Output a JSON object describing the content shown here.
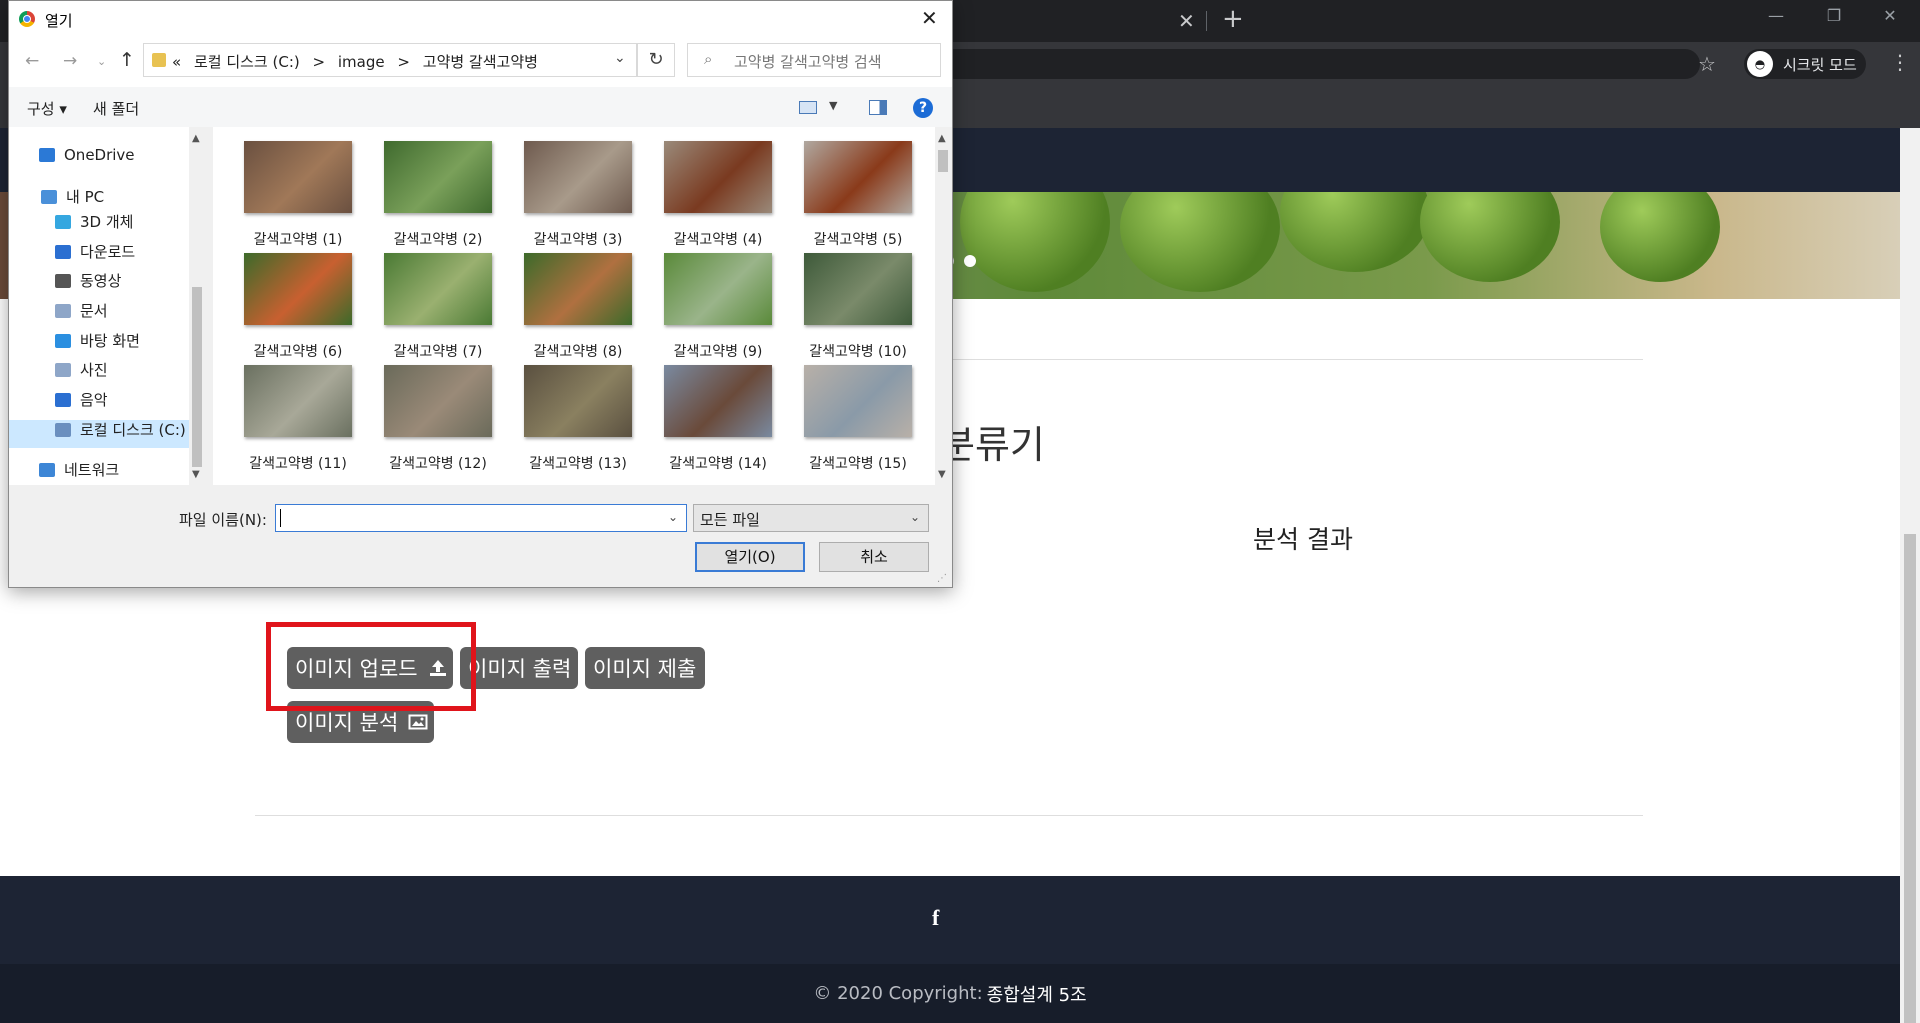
{
  "browser": {
    "new_tab_symbol": "+",
    "incognito_label": "시크릿 모드"
  },
  "page": {
    "title_visible": "분류기",
    "result_label": "분석 결과",
    "buttons": {
      "upload": "이미지 업로드",
      "print": "이미지 출력",
      "submit": "이미지 제출",
      "analyze": "이미지 분석"
    },
    "footer": {
      "facebook_icon": "f",
      "copyright": "© 2020 Copyright:",
      "brand": "종합설계 5조"
    },
    "highlight_color": "#e0141b"
  },
  "dialog": {
    "title": "열기",
    "breadcrumbs": [
      "«",
      "로컬 디스크 (C:)",
      ">",
      "image",
      ">",
      "고약병 갈색고약병"
    ],
    "search_placeholder": "고약병 갈색고약병 검색",
    "commands": {
      "organize": "구성 ▾",
      "new_folder": "새 폴더",
      "help": "?"
    },
    "nav_items": [
      {
        "label": "OneDrive",
        "icon": "cloud-icon",
        "color": "#2b79d6"
      },
      {
        "label": "내 PC",
        "icon": "pc-icon",
        "color": "#4a90d9"
      },
      {
        "label": "3D 개체",
        "icon": "cube-icon",
        "color": "#35a7e0"
      },
      {
        "label": "다운로드",
        "icon": "download-icon",
        "color": "#2b6fd1"
      },
      {
        "label": "동영상",
        "icon": "video-icon",
        "color": "#555"
      },
      {
        "label": "문서",
        "icon": "document-icon",
        "color": "#8ea6c8"
      },
      {
        "label": "바탕 화면",
        "icon": "desktop-icon",
        "color": "#2b8fe0"
      },
      {
        "label": "사진",
        "icon": "pictures-icon",
        "color": "#8ea6c8"
      },
      {
        "label": "음악",
        "icon": "music-icon",
        "color": "#2b6fd1"
      },
      {
        "label": "로컬 디스크 (C:)",
        "icon": "drive-icon",
        "color": "#6a8fbf"
      },
      {
        "label": "네트워크",
        "icon": "network-icon",
        "color": "#3d86d6"
      }
    ],
    "files": [
      {
        "name": "갈색고약병 (1)",
        "c1": "#6a5040",
        "c2": "#a07858"
      },
      {
        "name": "갈색고약병 (2)",
        "c1": "#3f6a2e",
        "c2": "#7aa05a"
      },
      {
        "name": "갈색고약병 (3)",
        "c1": "#6e5a4e",
        "c2": "#a89a8a"
      },
      {
        "name": "갈색고약병 (4)",
        "c1": "#9a8a7a",
        "c2": "#7a3a20"
      },
      {
        "name": "갈색고약병 (5)",
        "c1": "#b0a8a0",
        "c2": "#8a3a1a"
      },
      {
        "name": "갈색고약병 (6)",
        "c1": "#3c6a2a",
        "c2": "#c86030"
      },
      {
        "name": "갈색고약병 (7)",
        "c1": "#4a7a34",
        "c2": "#9ab070"
      },
      {
        "name": "갈색고약병 (8)",
        "c1": "#3c6a2a",
        "c2": "#b07040"
      },
      {
        "name": "갈색고약병 (9)",
        "c1": "#5a8a3a",
        "c2": "#9ab48a"
      },
      {
        "name": "갈색고약병 (10)",
        "c1": "#3e5a3a",
        "c2": "#7a8a6a"
      },
      {
        "name": "갈색고약병 (11)",
        "c1": "#6a7060",
        "c2": "#a8a898"
      },
      {
        "name": "갈색고약병 (12)",
        "c1": "#6a6a5a",
        "c2": "#9a8a78"
      },
      {
        "name": "갈색고약병 (13)",
        "c1": "#5a5040",
        "c2": "#8a8060"
      },
      {
        "name": "갈색고약병 (14)",
        "c1": "#7a8aa0",
        "c2": "#6a4a3a"
      },
      {
        "name": "갈색고약병 (15)",
        "c1": "#b8b0a8",
        "c2": "#8a9aa8"
      }
    ],
    "filename_label": "파일 이름(N):",
    "filename_value": "",
    "file_type": "모든 파일",
    "open_button": "열기(O)",
    "cancel_button": "취소"
  }
}
